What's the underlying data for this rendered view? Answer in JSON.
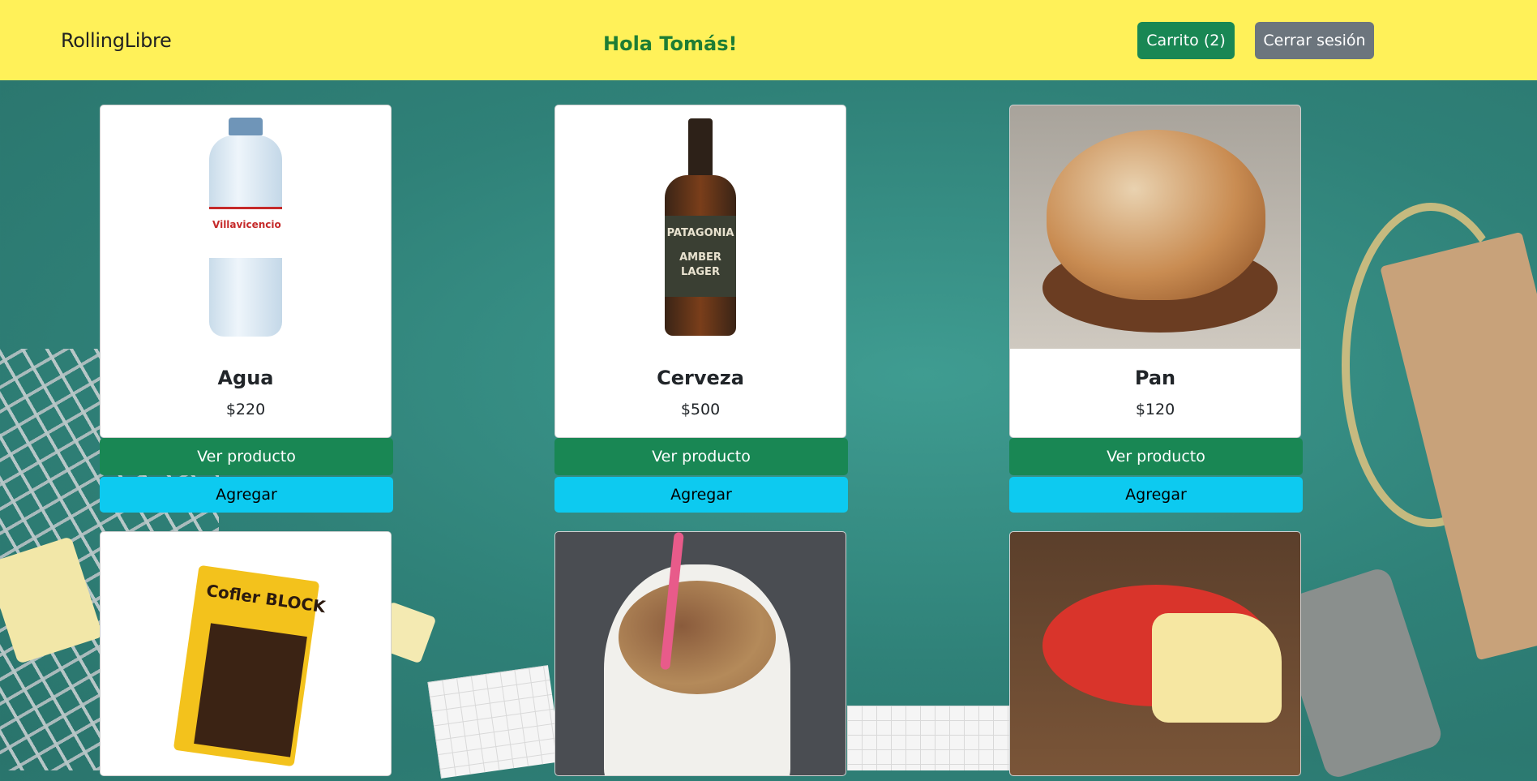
{
  "header": {
    "brand": "RollingLibre",
    "greeting": "Hola Tomás!",
    "cart_label": "Carrito (2)",
    "logout_label": "Cerrar sesión"
  },
  "colors": {
    "header_bg": "#fff159",
    "greeting": "#1e7d34",
    "cart_button": "#198754",
    "logout_button": "#6c757d",
    "view_button": "#198754",
    "add_button": "#0dcaf0",
    "page_bg": "#2f8178"
  },
  "products": [
    {
      "name": "Agua",
      "price": "$220",
      "view_label": "Ver producto",
      "add_label": "Agregar"
    },
    {
      "name": "Cerveza",
      "price": "$500",
      "view_label": "Ver producto",
      "add_label": "Agregar"
    },
    {
      "name": "Pan",
      "price": "$120",
      "view_label": "Ver producto",
      "add_label": "Agregar"
    },
    {
      "name": "",
      "price": ""
    },
    {
      "name": "",
      "price": ""
    },
    {
      "name": "",
      "price": ""
    }
  ],
  "image_text": {
    "water_brand": "Villavicencio",
    "beer_line1": "PATAGONIA",
    "beer_line2": "AMBER",
    "beer_line3": "LAGER",
    "choc_brand": "Cofler BLOCK"
  }
}
